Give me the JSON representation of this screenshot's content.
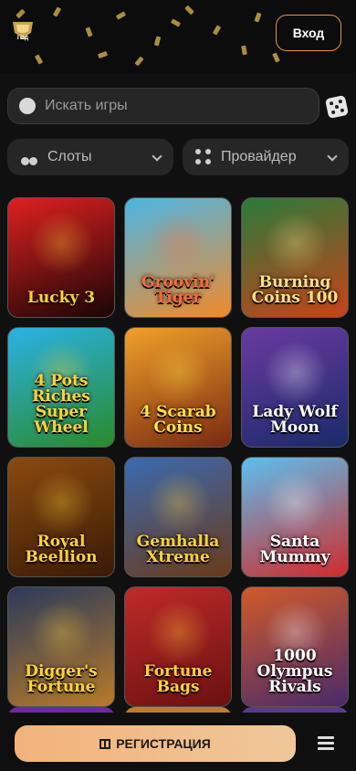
{
  "header": {
    "logo_text": "ГОД",
    "login_label": "Вход"
  },
  "search": {
    "placeholder": "Искать игры",
    "value": ""
  },
  "filters": {
    "slots_label": "Слоты",
    "provider_label": "Провайдер"
  },
  "games": [
    {
      "title": "Lucky 3",
      "colors": [
        "#e02020",
        "#1a0505"
      ],
      "accent": "#ffd23a"
    },
    {
      "title": "Groovin' Tiger",
      "colors": [
        "#4ab6e6",
        "#f08a2a"
      ],
      "accent": "#ff6a3a"
    },
    {
      "title": "Burning Coins 100",
      "colors": [
        "#2a7a3a",
        "#c8421a"
      ],
      "accent": "#ffe08a"
    },
    {
      "title": "4 Pots Riches Super Wheel",
      "colors": [
        "#2ab2e6",
        "#2a8a2a"
      ],
      "accent": "#ffd23a"
    },
    {
      "title": "4 Scarab Coins",
      "colors": [
        "#f0a02a",
        "#7a2a10"
      ],
      "accent": "#ffe04a"
    },
    {
      "title": "Lady Wolf Moon",
      "colors": [
        "#6a3aa0",
        "#1a2a6a"
      ],
      "accent": "#ffffff"
    },
    {
      "title": "Royal Beellion",
      "colors": [
        "#8a4a10",
        "#3a1a05"
      ],
      "accent": "#ffd23a"
    },
    {
      "title": "Gemhalla Xtreme",
      "colors": [
        "#3a6ab0",
        "#6a3a1a"
      ],
      "accent": "#ffd23a"
    },
    {
      "title": "Santa Mummy",
      "colors": [
        "#5ac0f0",
        "#d02a2a"
      ],
      "accent": "#ffffff"
    },
    {
      "title": "Digger's Fortune",
      "colors": [
        "#2a3a5a",
        "#b87a2a"
      ],
      "accent": "#ffd23a"
    },
    {
      "title": "Fortune Bags",
      "colors": [
        "#c02a2a",
        "#6a1010"
      ],
      "accent": "#ffd23a"
    },
    {
      "title": "1000 Olympus Rivals",
      "colors": [
        "#d05a2a",
        "#4a2a6a"
      ],
      "accent": "#ffffff"
    }
  ],
  "bottom": {
    "register_label": "РЕГИСТРАЦИЯ"
  },
  "colors": {
    "background": "#101010",
    "accent_border": "#e8944a",
    "cta_gradient_start": "#f2b27a",
    "cta_gradient_end": "#f0c79a"
  }
}
